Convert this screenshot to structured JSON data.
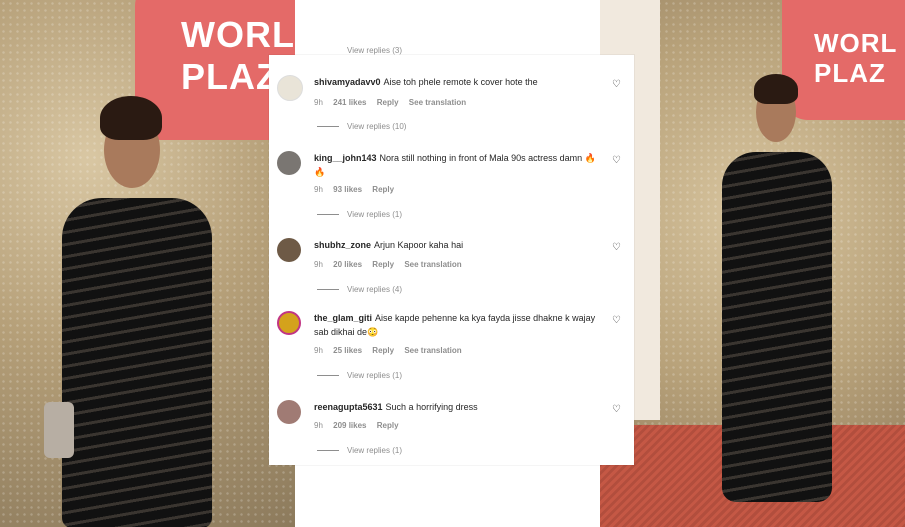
{
  "left_photo": {
    "sign_text": "WORL\nPLAZ"
  },
  "right_photo": {
    "sign_text": "WORL\nPLAZ"
  },
  "top_partial_replies": "View replies (3)",
  "comments": [
    {
      "username": "shivamyadavv0",
      "text": "Aise toh phele remote k cover hote the",
      "time": "9h",
      "likes": "241 likes",
      "reply": "Reply",
      "translate": "See translation",
      "view_replies": "View replies (10)",
      "avatar_color": "#e9e4d8"
    },
    {
      "username": "king__john143",
      "text": "Nora still nothing in front of Mala 90s actress damn 🔥🔥",
      "time": "9h",
      "likes": "93 likes",
      "reply": "Reply",
      "translate": "",
      "view_replies": "View replies (1)",
      "avatar_color": "#7a7672"
    },
    {
      "username": "shubhz_zone",
      "text": "Arjun Kapoor kaha hai",
      "time": "9h",
      "likes": "20 likes",
      "reply": "Reply",
      "translate": "See translation",
      "view_replies": "View replies (4)",
      "avatar_color": "#6e5a46"
    },
    {
      "username": "the_glam_giti",
      "text": "Aise kapde pehenne ka kya fayda jisse dhakne k wajay sab dikhai de😳",
      "time": "9h",
      "likes": "25 likes",
      "reply": "Reply",
      "translate": "See translation",
      "view_replies": "View replies (1)",
      "avatar_color": "#d4a21c"
    },
    {
      "username": "reenagupta5631",
      "text": "Such a horrifying dress",
      "time": "9h",
      "likes": "209 likes",
      "reply": "Reply",
      "translate": "",
      "view_replies": "View replies (1)",
      "avatar_color": "#a07b74"
    }
  ]
}
